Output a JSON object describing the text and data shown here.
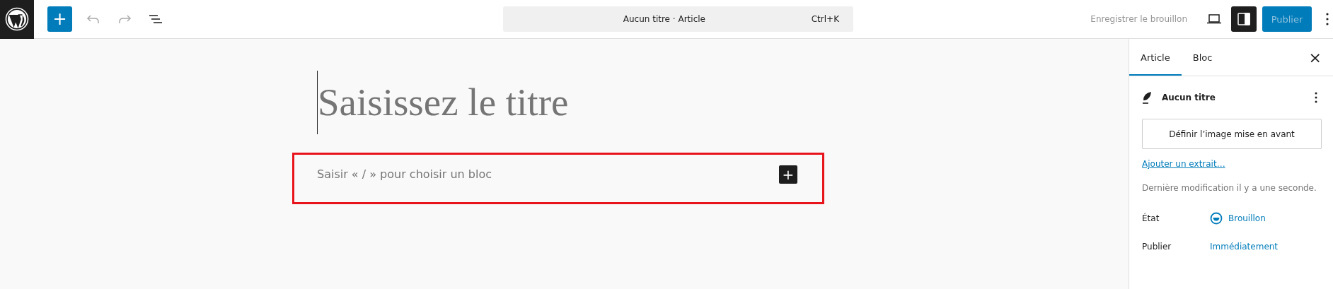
{
  "header": {
    "add_block": {
      "label": "+"
    },
    "undo": {
      "disabled": true
    },
    "redo": {
      "disabled": true
    },
    "command_bar": {
      "title": "Aucun titre · Article",
      "shortcut": "Ctrl+K"
    },
    "save_draft": {
      "label": "Enregistrer le brouillon",
      "disabled": true
    },
    "settings_toggle": {
      "pressed": true
    },
    "publish": {
      "label": "Publier",
      "disabled": true
    }
  },
  "editor": {
    "title_placeholder": "Saisissez le titre",
    "block": {
      "placeholder": "Saisir « / » pour choisir un bloc",
      "highlighted": true,
      "add_label": "+"
    }
  },
  "sidebar": {
    "tabs": [
      {
        "label": "Article",
        "selected": true
      },
      {
        "label": "Bloc",
        "selected": false
      }
    ],
    "close": "×",
    "post_title": "Aucun titre",
    "featured_image_button": "Définir l’image mise en avant",
    "excerpt_link": "Ajouter un extrait…",
    "last_modified": "Dernière modification il y a une seconde.",
    "fields": [
      {
        "label": "État",
        "value": "Brouillon",
        "kind": "status"
      },
      {
        "label": "Publier",
        "value": "Immédiatement",
        "kind": "link"
      }
    ]
  }
}
